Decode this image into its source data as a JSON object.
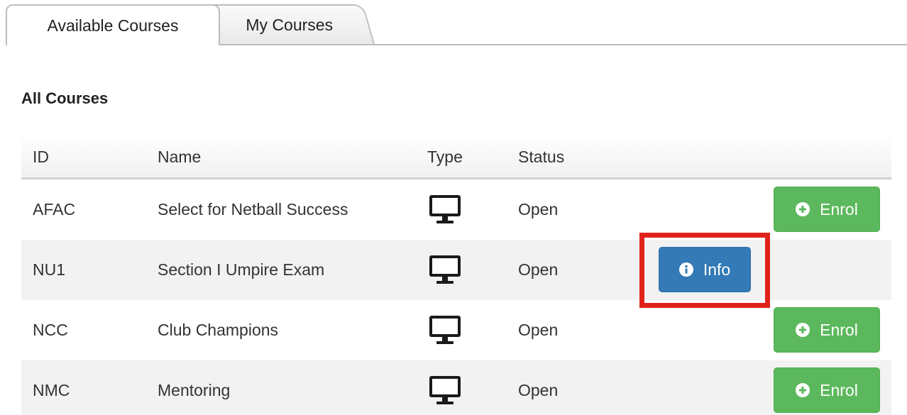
{
  "tabs": [
    {
      "label": "Available Courses",
      "active": true
    },
    {
      "label": "My Courses",
      "active": false
    }
  ],
  "section_title": "All Courses",
  "table": {
    "headers": {
      "id": "ID",
      "name": "Name",
      "type": "Type",
      "status": "Status"
    },
    "rows": [
      {
        "id": "AFAC",
        "name": "Select for Netball Success",
        "type_icon": "monitor-icon",
        "status": "Open",
        "action": "Enrol"
      },
      {
        "id": "NU1",
        "name": "Section I Umpire Exam",
        "type_icon": "monitor-icon",
        "status": "Open",
        "action": "Info"
      },
      {
        "id": "NCC",
        "name": "Club Champions",
        "type_icon": "monitor-icon",
        "status": "Open",
        "action": "Enrol"
      },
      {
        "id": "NMC",
        "name": "Mentoring",
        "type_icon": "monitor-icon",
        "status": "Open",
        "action": "Enrol"
      }
    ]
  },
  "colors": {
    "enrol_button": "#5cb85c",
    "info_button": "#337ab7",
    "highlight": "#e0221b"
  }
}
